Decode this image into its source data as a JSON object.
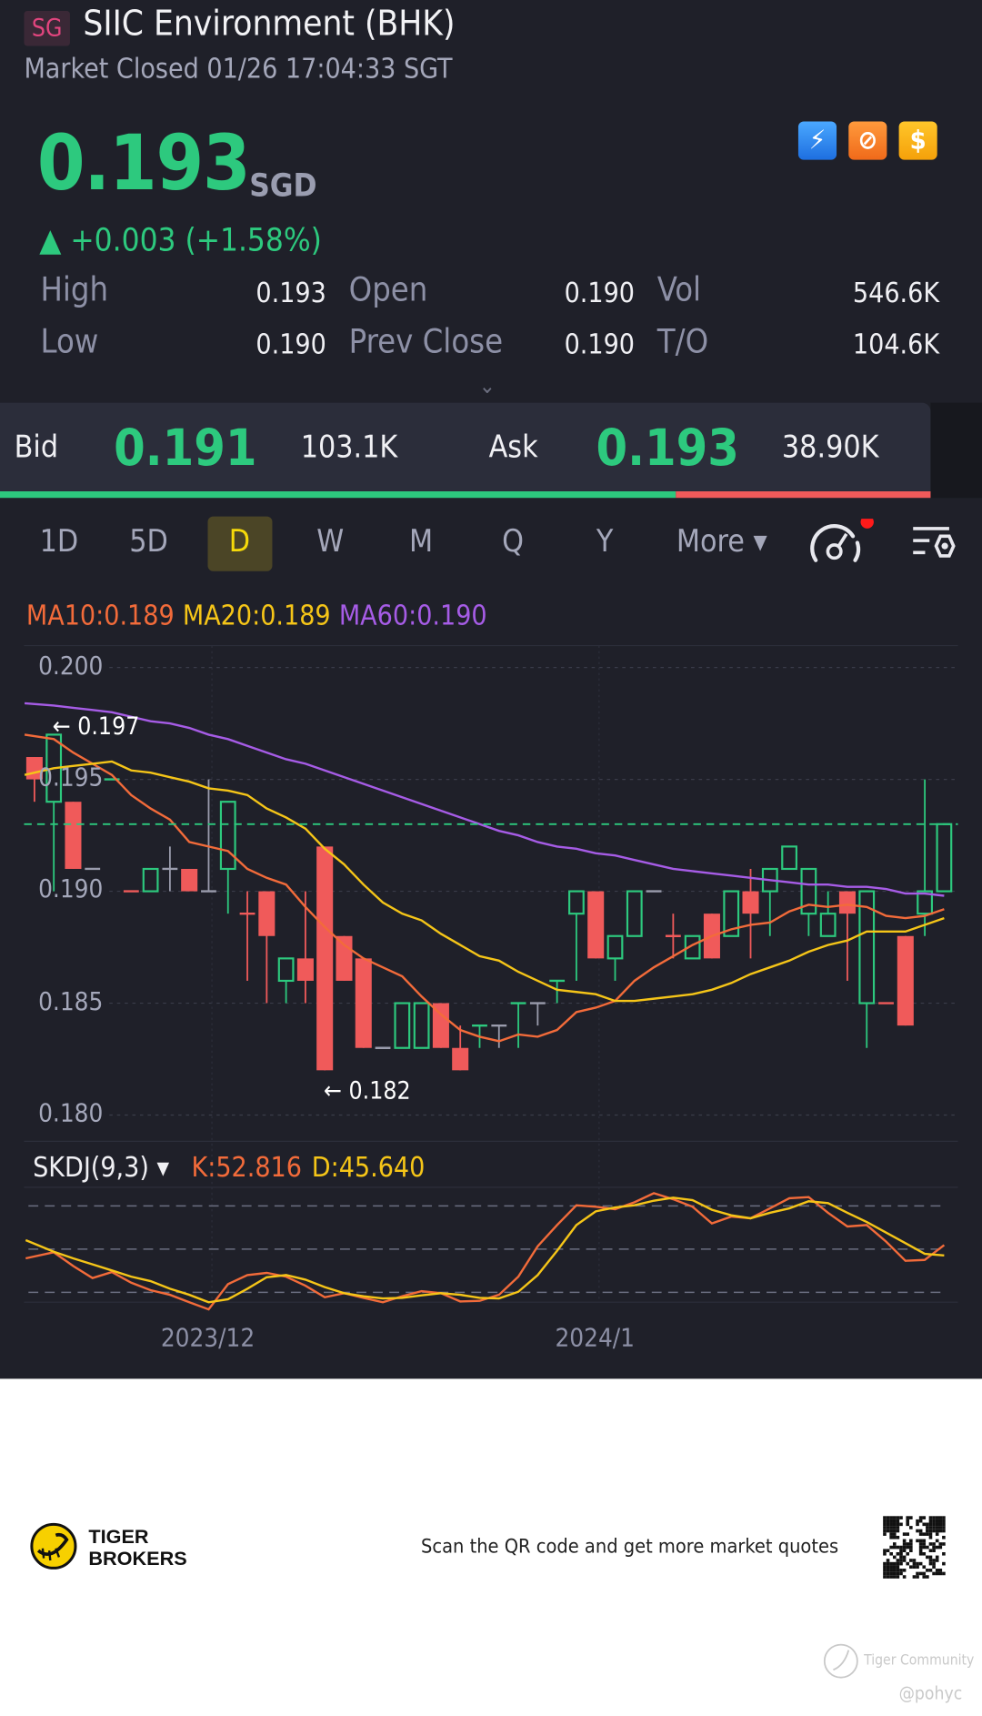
{
  "header": {
    "market_badge": "SG",
    "title": "SIIC Environment (BHK)",
    "status": "Market Closed 01/26 17:04:33 SGT",
    "price": "0.193",
    "currency": "SGD",
    "change": "▲ +0.003 (+1.58%)",
    "icons": [
      "flash-icon",
      "exchange-icon",
      "dollar-icon"
    ],
    "icon_glyphs": [
      "⚡",
      "⊘",
      "$"
    ]
  },
  "stats": {
    "high_label": "High",
    "high": "0.193",
    "open_label": "Open",
    "open": "0.190",
    "vol_label": "Vol",
    "vol": "546.6K",
    "low_label": "Low",
    "low": "0.190",
    "prev_close_label": "Prev Close",
    "prev_close": "0.190",
    "to_label": "T/O",
    "to": "104.6K",
    "expand_glyph": "⌄"
  },
  "orderbook": {
    "bid_label": "Bid",
    "bid": "0.191",
    "bid_size": "103.1K",
    "ask_label": "Ask",
    "ask": "0.193",
    "ask_size": "38.90K",
    "bid_share": 0.726
  },
  "tabs": {
    "items": [
      "1D",
      "5D",
      "D",
      "W",
      "M",
      "Q",
      "Y",
      "More ▾"
    ],
    "active": "D"
  },
  "ma_legend": {
    "ma10": "MA10:0.189",
    "ma20": "MA20:0.189",
    "ma60": "MA60:0.190"
  },
  "kdj_legend": {
    "name": "SKDJ(9,3) ▾",
    "k": "K:52.816",
    "d": "D:45.640"
  },
  "colors": {
    "up": "#2dc97e",
    "down": "#f05a5a",
    "flat": "#9a9cad",
    "ma10": "#f26b3a",
    "ma20": "#f5c518",
    "ma60": "#a65ce6",
    "k": "#f26b3a",
    "d": "#f5c518"
  },
  "chart_data": [
    {
      "type": "candlestick",
      "ylim": [
        0.18,
        0.2
      ],
      "y_ticks": [
        "0.200",
        "0.195",
        "0.190",
        "0.185",
        "0.180"
      ],
      "x_ticks": [
        {
          "index": 9,
          "label": "2023/12"
        },
        {
          "index": 29,
          "label": "2024/1"
        }
      ],
      "current_price_line": 0.193,
      "annotations": [
        {
          "index": 1,
          "value": 0.197,
          "label": "← 0.197"
        },
        {
          "index": 15,
          "value": 0.182,
          "label": "← 0.182"
        }
      ],
      "ohlc": [
        [
          0.196,
          0.196,
          0.194,
          0.195
        ],
        [
          0.194,
          0.197,
          0.19,
          0.197
        ],
        [
          0.194,
          0.194,
          0.191,
          0.191
        ],
        [
          0.191,
          0.191,
          0.191,
          0.191
        ],
        [
          0.195,
          0.195,
          0.195,
          0.195
        ],
        [
          0.19,
          0.19,
          0.19,
          0.19
        ],
        [
          0.19,
          0.191,
          0.19,
          0.191
        ],
        [
          0.191,
          0.192,
          0.19,
          0.191
        ],
        [
          0.191,
          0.191,
          0.19,
          0.19
        ],
        [
          0.19,
          0.195,
          0.19,
          0.19
        ],
        [
          0.191,
          0.194,
          0.189,
          0.194
        ],
        [
          0.189,
          0.19,
          0.186,
          0.189
        ],
        [
          0.19,
          0.19,
          0.185,
          0.188
        ],
        [
          0.186,
          0.187,
          0.185,
          0.187
        ],
        [
          0.187,
          0.19,
          0.185,
          0.186
        ],
        [
          0.192,
          0.192,
          0.182,
          0.182
        ],
        [
          0.188,
          0.188,
          0.186,
          0.186
        ],
        [
          0.187,
          0.187,
          0.183,
          0.183
        ],
        [
          0.183,
          0.183,
          0.183,
          0.183
        ],
        [
          0.183,
          0.185,
          0.183,
          0.185
        ],
        [
          0.183,
          0.185,
          0.183,
          0.185
        ],
        [
          0.185,
          0.185,
          0.183,
          0.183
        ],
        [
          0.183,
          0.184,
          0.182,
          0.182
        ],
        [
          0.184,
          0.184,
          0.183,
          0.184
        ],
        [
          0.184,
          0.184,
          0.183,
          0.184
        ],
        [
          0.185,
          0.185,
          0.183,
          0.185
        ],
        [
          0.185,
          0.185,
          0.184,
          0.185
        ],
        [
          0.186,
          0.186,
          0.185,
          0.186
        ],
        [
          0.189,
          0.19,
          0.186,
          0.19
        ],
        [
          0.19,
          0.19,
          0.187,
          0.187
        ],
        [
          0.187,
          0.188,
          0.186,
          0.188
        ],
        [
          0.188,
          0.19,
          0.188,
          0.19
        ],
        [
          0.19,
          0.19,
          0.19,
          0.19
        ],
        [
          0.188,
          0.189,
          0.187,
          0.188
        ],
        [
          0.187,
          0.188,
          0.187,
          0.188
        ],
        [
          0.189,
          0.189,
          0.187,
          0.187
        ],
        [
          0.188,
          0.19,
          0.188,
          0.19
        ],
        [
          0.19,
          0.191,
          0.187,
          0.189
        ],
        [
          0.19,
          0.191,
          0.188,
          0.191
        ],
        [
          0.191,
          0.192,
          0.191,
          0.192
        ],
        [
          0.189,
          0.191,
          0.188,
          0.191
        ],
        [
          0.188,
          0.19,
          0.188,
          0.189
        ],
        [
          0.19,
          0.19,
          0.186,
          0.189
        ],
        [
          0.185,
          0.19,
          0.183,
          0.19
        ],
        [
          0.185,
          0.185,
          0.185,
          0.185
        ],
        [
          0.188,
          0.188,
          0.184,
          0.184
        ],
        [
          0.189,
          0.195,
          0.188,
          0.19
        ],
        [
          0.19,
          0.193,
          0.19,
          0.193
        ]
      ],
      "series": [
        {
          "name": "MA10",
          "values": [
            0.197,
            0.1968,
            0.1962,
            0.1957,
            0.1952,
            0.1943,
            0.1937,
            0.1932,
            0.1922,
            0.192,
            0.1918,
            0.191,
            0.1906,
            0.1903,
            0.1893,
            0.1884,
            0.1876,
            0.187,
            0.1866,
            0.1862,
            0.1853,
            0.1845,
            0.1838,
            0.1835,
            0.1833,
            0.1836,
            0.1835,
            0.1838,
            0.1846,
            0.1848,
            0.1851,
            0.186,
            0.1866,
            0.1871,
            0.1876,
            0.188,
            0.1883,
            0.1885,
            0.1886,
            0.1891,
            0.1894,
            0.1893,
            0.1894,
            0.1893,
            0.1889,
            0.1888,
            0.1889,
            0.1892
          ]
        },
        {
          "name": "MA20",
          "values": [
            0.1952,
            0.1955,
            0.1956,
            0.1957,
            0.1958,
            0.1954,
            0.1953,
            0.1951,
            0.1949,
            0.1946,
            0.1945,
            0.1943,
            0.1937,
            0.1933,
            0.1928,
            0.1919,
            0.1912,
            0.1903,
            0.1895,
            0.189,
            0.1887,
            0.1881,
            0.1876,
            0.1871,
            0.1869,
            0.1864,
            0.186,
            0.1856,
            0.1855,
            0.1854,
            0.1851,
            0.1851,
            0.1852,
            0.1853,
            0.1854,
            0.1856,
            0.1859,
            0.1863,
            0.1866,
            0.1869,
            0.1873,
            0.1876,
            0.1878,
            0.1882,
            0.1882,
            0.1882,
            0.1885,
            0.1888
          ]
        },
        {
          "name": "MA60",
          "values": [
            0.1984,
            0.1983,
            0.1982,
            0.1981,
            0.198,
            0.1978,
            0.1976,
            0.1975,
            0.1973,
            0.197,
            0.1968,
            0.1965,
            0.1962,
            0.1959,
            0.1957,
            0.1954,
            0.1951,
            0.1948,
            0.1945,
            0.1942,
            0.1939,
            0.1936,
            0.1933,
            0.193,
            0.1927,
            0.1925,
            0.1922,
            0.192,
            0.1919,
            0.1917,
            0.1916,
            0.1914,
            0.1912,
            0.191,
            0.1909,
            0.1908,
            0.1907,
            0.1906,
            0.1905,
            0.1904,
            0.1903,
            0.1903,
            0.1902,
            0.1902,
            0.1901,
            0.1899,
            0.1899,
            0.1898
          ]
        }
      ]
    },
    {
      "type": "line",
      "title": "SKDJ(9,3)",
      "reference_lines": [
        80,
        50,
        20
      ],
      "series": [
        {
          "name": "K",
          "values": [
            43.6,
            47.8,
            38.3,
            29.9,
            34.1,
            26.7,
            21.5,
            18.3,
            13.1,
            8.2,
            25.7,
            32.0,
            33.5,
            30.9,
            24.6,
            16.6,
            19.4,
            16.2,
            13.1,
            17.3,
            20.8,
            19.4,
            13.7,
            14.1,
            18.3,
            30.9,
            52.0,
            66.7,
            80.4,
            79.4,
            77.7,
            82.5,
            88.8,
            84.6,
            79.4,
            67.8,
            72.6,
            71.4,
            78.3,
            85.3,
            86.1,
            75.2,
            65.7,
            66.7,
            55.2,
            41.9,
            42.5,
            52.8
          ]
        },
        {
          "name": "D",
          "values": [
            56.2,
            48.2,
            43.6,
            39.4,
            35.2,
            30.9,
            27.8,
            22.5,
            18.3,
            13.1,
            15.2,
            22.5,
            30.5,
            32.0,
            28.8,
            23.6,
            19.4,
            17.3,
            15.8,
            16.2,
            17.9,
            19.4,
            18.3,
            16.2,
            15.8,
            20.4,
            32.0,
            48.8,
            66.7,
            76.2,
            78.9,
            80.4,
            83.6,
            85.7,
            84.0,
            77.3,
            73.5,
            71.4,
            75.2,
            78.3,
            83.2,
            81.9,
            75.2,
            68.8,
            61.5,
            54.1,
            46.7,
            45.6
          ]
        }
      ]
    }
  ],
  "footer": {
    "brand_line1": "TIGER",
    "brand_line2": "BROKERS",
    "scan_text": "Scan the QR code and get more market quotes",
    "watermark": "Tiger Community",
    "user": "@pohyc"
  }
}
